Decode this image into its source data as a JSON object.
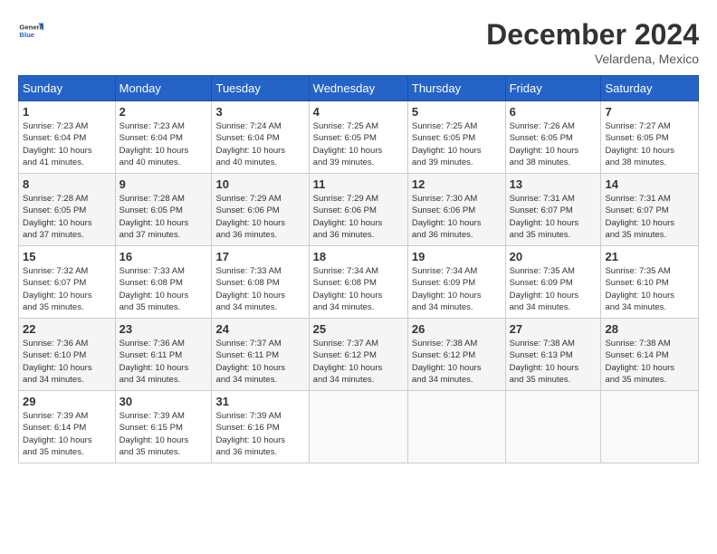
{
  "header": {
    "logo": {
      "general": "General",
      "blue": "Blue"
    },
    "title": "December 2024",
    "location": "Velardena, Mexico"
  },
  "calendar": {
    "days_of_week": [
      "Sunday",
      "Monday",
      "Tuesday",
      "Wednesday",
      "Thursday",
      "Friday",
      "Saturday"
    ],
    "weeks": [
      [
        {
          "day": "",
          "info": ""
        },
        {
          "day": "2",
          "info": "Sunrise: 7:23 AM\nSunset: 6:04 PM\nDaylight: 10 hours\nand 40 minutes."
        },
        {
          "day": "3",
          "info": "Sunrise: 7:24 AM\nSunset: 6:04 PM\nDaylight: 10 hours\nand 40 minutes."
        },
        {
          "day": "4",
          "info": "Sunrise: 7:25 AM\nSunset: 6:05 PM\nDaylight: 10 hours\nand 39 minutes."
        },
        {
          "day": "5",
          "info": "Sunrise: 7:25 AM\nSunset: 6:05 PM\nDaylight: 10 hours\nand 39 minutes."
        },
        {
          "day": "6",
          "info": "Sunrise: 7:26 AM\nSunset: 6:05 PM\nDaylight: 10 hours\nand 38 minutes."
        },
        {
          "day": "7",
          "info": "Sunrise: 7:27 AM\nSunset: 6:05 PM\nDaylight: 10 hours\nand 38 minutes."
        }
      ],
      [
        {
          "day": "1",
          "info": "Sunrise: 7:23 AM\nSunset: 6:04 PM\nDaylight: 10 hours\nand 41 minutes."
        },
        {
          "day": "9",
          "info": "Sunrise: 7:28 AM\nSunset: 6:05 PM\nDaylight: 10 hours\nand 37 minutes."
        },
        {
          "day": "10",
          "info": "Sunrise: 7:29 AM\nSunset: 6:06 PM\nDaylight: 10 hours\nand 36 minutes."
        },
        {
          "day": "11",
          "info": "Sunrise: 7:29 AM\nSunset: 6:06 PM\nDaylight: 10 hours\nand 36 minutes."
        },
        {
          "day": "12",
          "info": "Sunrise: 7:30 AM\nSunset: 6:06 PM\nDaylight: 10 hours\nand 36 minutes."
        },
        {
          "day": "13",
          "info": "Sunrise: 7:31 AM\nSunset: 6:07 PM\nDaylight: 10 hours\nand 35 minutes."
        },
        {
          "day": "14",
          "info": "Sunrise: 7:31 AM\nSunset: 6:07 PM\nDaylight: 10 hours\nand 35 minutes."
        }
      ],
      [
        {
          "day": "8",
          "info": "Sunrise: 7:28 AM\nSunset: 6:05 PM\nDaylight: 10 hours\nand 37 minutes."
        },
        {
          "day": "16",
          "info": "Sunrise: 7:33 AM\nSunset: 6:08 PM\nDaylight: 10 hours\nand 35 minutes."
        },
        {
          "day": "17",
          "info": "Sunrise: 7:33 AM\nSunset: 6:08 PM\nDaylight: 10 hours\nand 34 minutes."
        },
        {
          "day": "18",
          "info": "Sunrise: 7:34 AM\nSunset: 6:08 PM\nDaylight: 10 hours\nand 34 minutes."
        },
        {
          "day": "19",
          "info": "Sunrise: 7:34 AM\nSunset: 6:09 PM\nDaylight: 10 hours\nand 34 minutes."
        },
        {
          "day": "20",
          "info": "Sunrise: 7:35 AM\nSunset: 6:09 PM\nDaylight: 10 hours\nand 34 minutes."
        },
        {
          "day": "21",
          "info": "Sunrise: 7:35 AM\nSunset: 6:10 PM\nDaylight: 10 hours\nand 34 minutes."
        }
      ],
      [
        {
          "day": "15",
          "info": "Sunrise: 7:32 AM\nSunset: 6:07 PM\nDaylight: 10 hours\nand 35 minutes."
        },
        {
          "day": "23",
          "info": "Sunrise: 7:36 AM\nSunset: 6:11 PM\nDaylight: 10 hours\nand 34 minutes."
        },
        {
          "day": "24",
          "info": "Sunrise: 7:37 AM\nSunset: 6:11 PM\nDaylight: 10 hours\nand 34 minutes."
        },
        {
          "day": "25",
          "info": "Sunrise: 7:37 AM\nSunset: 6:12 PM\nDaylight: 10 hours\nand 34 minutes."
        },
        {
          "day": "26",
          "info": "Sunrise: 7:38 AM\nSunset: 6:12 PM\nDaylight: 10 hours\nand 34 minutes."
        },
        {
          "day": "27",
          "info": "Sunrise: 7:38 AM\nSunset: 6:13 PM\nDaylight: 10 hours\nand 35 minutes."
        },
        {
          "day": "28",
          "info": "Sunrise: 7:38 AM\nSunset: 6:14 PM\nDaylight: 10 hours\nand 35 minutes."
        }
      ],
      [
        {
          "day": "22",
          "info": "Sunrise: 7:36 AM\nSunset: 6:10 PM\nDaylight: 10 hours\nand 34 minutes."
        },
        {
          "day": "30",
          "info": "Sunrise: 7:39 AM\nSunset: 6:15 PM\nDaylight: 10 hours\nand 35 minutes."
        },
        {
          "day": "31",
          "info": "Sunrise: 7:39 AM\nSunset: 6:16 PM\nDaylight: 10 hours\nand 36 minutes."
        },
        {
          "day": "",
          "info": ""
        },
        {
          "day": "",
          "info": ""
        },
        {
          "day": "",
          "info": ""
        },
        {
          "day": ""
        }
      ],
      [
        {
          "day": "29",
          "info": "Sunrise: 7:39 AM\nSunset: 6:14 PM\nDaylight: 10 hours\nand 35 minutes."
        },
        {
          "day": "",
          "info": ""
        },
        {
          "day": "",
          "info": ""
        },
        {
          "day": "",
          "info": ""
        },
        {
          "day": "",
          "info": ""
        },
        {
          "day": "",
          "info": ""
        },
        {
          "day": "",
          "info": ""
        }
      ]
    ]
  }
}
